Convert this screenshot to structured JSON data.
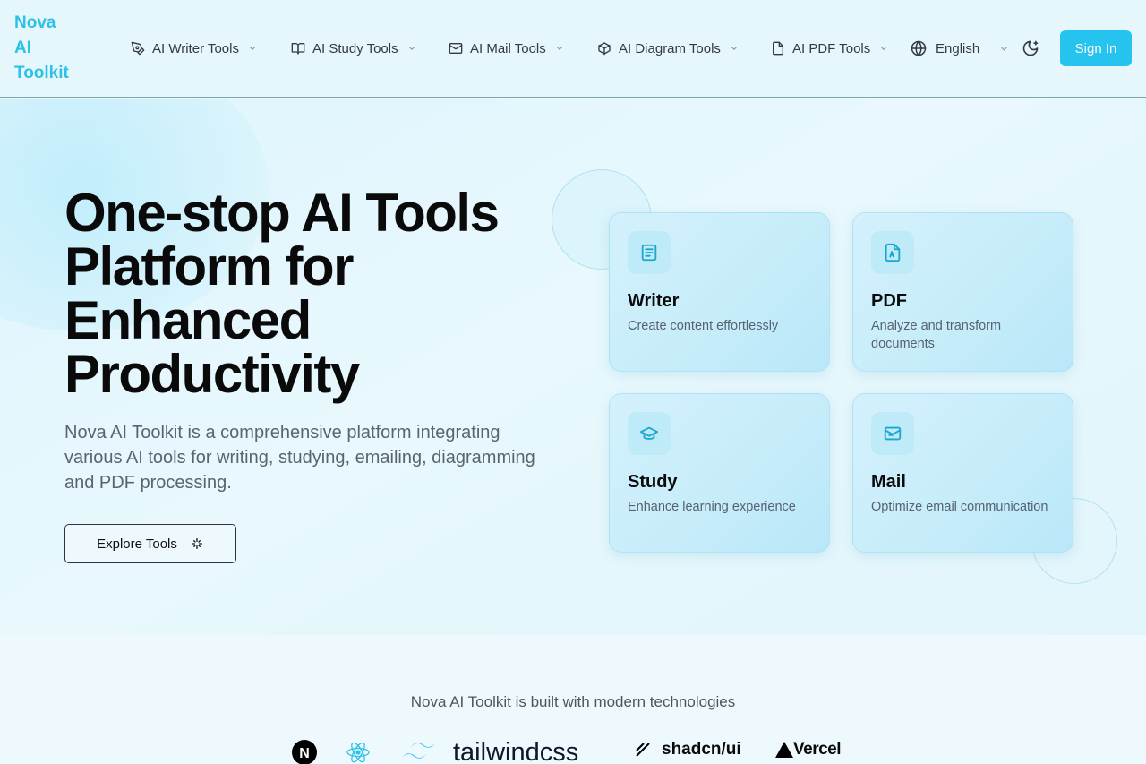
{
  "brand": {
    "line1": "Nova",
    "line2": "AI",
    "line3": "Toolkit"
  },
  "nav": {
    "items": [
      {
        "label": "AI Writer Tools",
        "icon": "pen-icon"
      },
      {
        "label": "AI Study Tools",
        "icon": "book-icon"
      },
      {
        "label": "AI Mail Tools",
        "icon": "mail-icon"
      },
      {
        "label": "AI Diagram Tools",
        "icon": "cube-icon"
      },
      {
        "label": "AI PDF Tools",
        "icon": "file-icon"
      }
    ],
    "language": "English",
    "sign_in": "Sign In"
  },
  "hero": {
    "title": "One-stop AI Tools Platform for Enhanced Productivity",
    "subtitle": "Nova AI Toolkit is a comprehensive platform integrating various AI tools for writing, studying, emailing, diagramming and PDF processing.",
    "cta": "Explore Tools"
  },
  "cards": [
    {
      "title": "Writer",
      "desc": "Create content effortlessly",
      "icon": "document-icon"
    },
    {
      "title": "PDF",
      "desc": "Analyze and transform documents",
      "icon": "pdf-icon"
    },
    {
      "title": "Study",
      "desc": "Enhance learning experience",
      "icon": "graduation-cap-icon"
    },
    {
      "title": "Mail",
      "desc": "Optimize email communication",
      "icon": "mail-open-icon"
    }
  ],
  "tech": {
    "caption": "Nova AI Toolkit is built with modern technologies",
    "logos": [
      "N",
      "tailwindcss",
      "shadcn/ui",
      "Vercel"
    ]
  },
  "colors": {
    "accent": "#26c3ef",
    "brand": "#2cc2e6",
    "nav_bg": "#e6f7fc"
  }
}
